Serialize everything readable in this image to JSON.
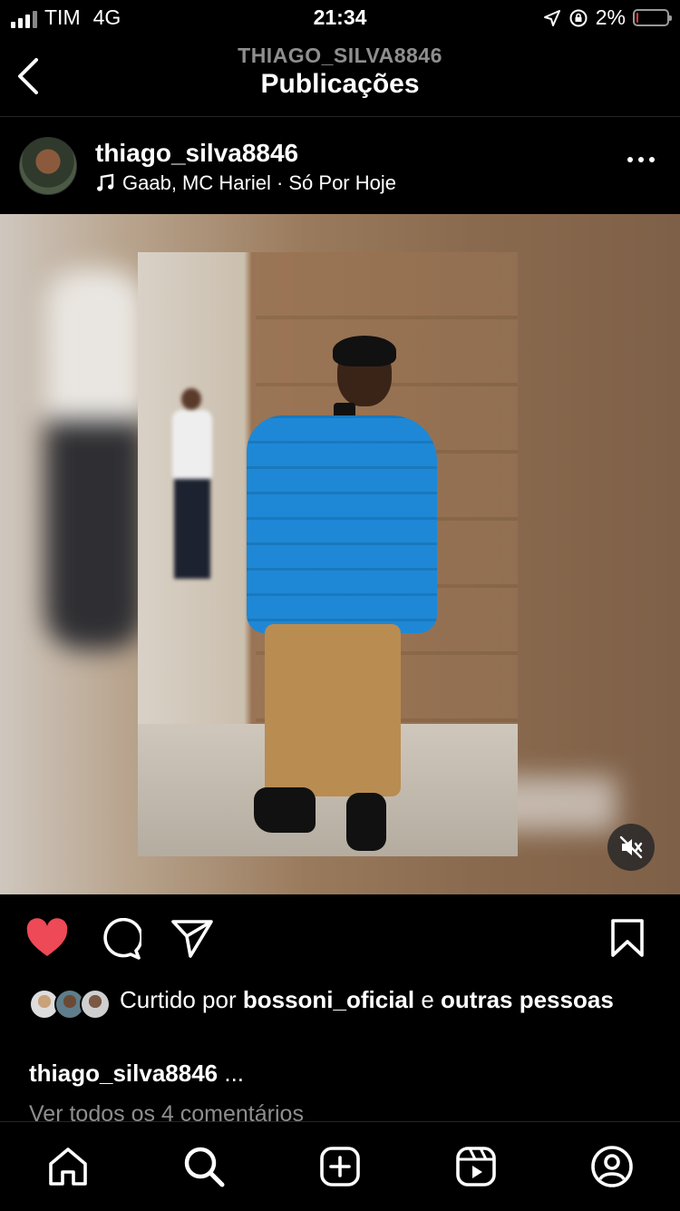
{
  "status_bar": {
    "carrier": "TIM",
    "network": "4G",
    "time": "21:34",
    "battery": "2%"
  },
  "header": {
    "subtitle": "THIAGO_SILVA8846",
    "title": "Publicações"
  },
  "post": {
    "username": "thiago_silva8846",
    "music": "Gaab, MC Hariel · Só Por Hoje",
    "liked_prefix": "Curtido por ",
    "liked_user": "bossoni_oficial",
    "liked_connector": " e ",
    "liked_others": "outras pessoas",
    "caption_user": "thiago_silva8846",
    "caption_more": " ...",
    "view_comments": "Ver todos os 4 comentários"
  },
  "colors": {
    "like_red": "#ed4956",
    "jacket_blue": "#1e88d6",
    "muted_text": "#8e8e8e"
  },
  "icons": {
    "back": "chevron-left-icon",
    "more": "more-horizontal-icon",
    "music": "music-note-icon",
    "mute": "volume-off-icon",
    "like": "heart-filled-icon",
    "comment": "comment-icon",
    "share": "send-icon",
    "save": "bookmark-icon",
    "home": "home-icon",
    "search": "search-icon",
    "create": "plus-square-icon",
    "reels": "reels-icon",
    "profile": "profile-icon"
  }
}
